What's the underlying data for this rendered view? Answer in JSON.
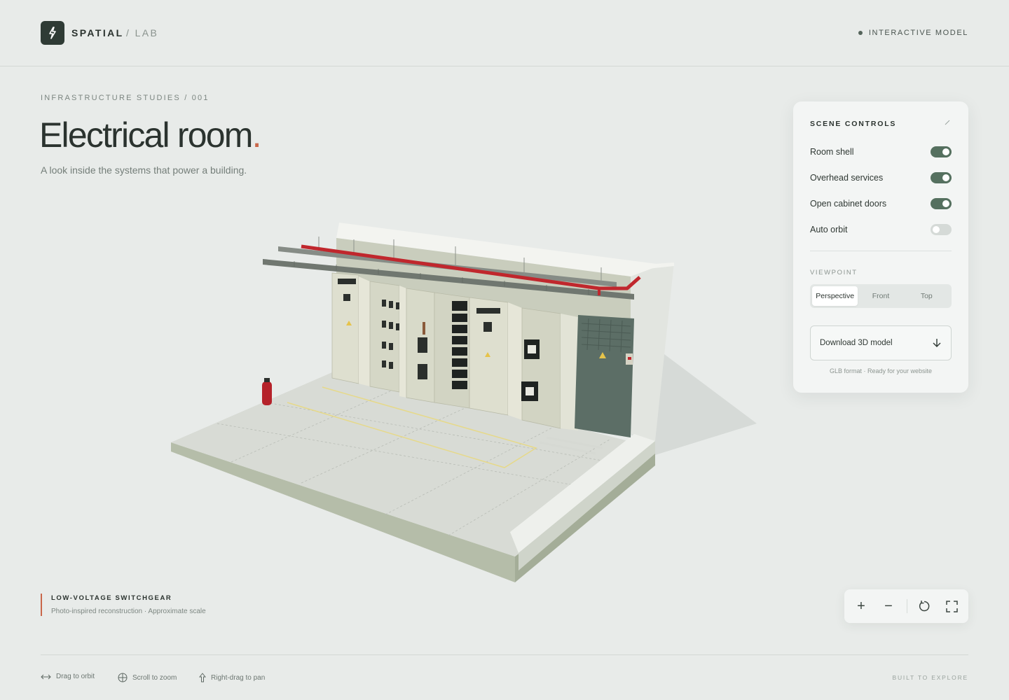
{
  "header": {
    "brand": "SPATIAL",
    "brand_sub": "/ LAB",
    "status": "INTERACTIVE MODEL",
    "logo_icon": "lightning-icon"
  },
  "hero": {
    "eyebrow": "INFRASTRUCTURE STUDIES / 001",
    "title": "Electrical room",
    "title_dot": ".",
    "subtitle": "A look inside the systems that power a building."
  },
  "panel": {
    "title": "SCENE CONTROLS",
    "toggles": [
      {
        "label": "Room shell",
        "on": true
      },
      {
        "label": "Overhead services",
        "on": true
      },
      {
        "label": "Open cabinet doors",
        "on": true
      },
      {
        "label": "Auto orbit",
        "on": false
      }
    ],
    "viewpoint_label": "VIEWPOINT",
    "viewpoints": [
      "Perspective",
      "Front",
      "Top"
    ],
    "active_viewpoint": "Perspective",
    "download_label": "Download 3D model",
    "download_note": "GLB format · Ready for your website"
  },
  "caption": {
    "title": "LOW-VOLTAGE SWITCHGEAR",
    "subtitle": "Photo-inspired reconstruction · Approximate scale"
  },
  "zoom": {
    "zoom_in": "+",
    "zoom_out": "−"
  },
  "footer": {
    "hints": [
      {
        "icon": "arrows-horizontal-icon",
        "label": "Drag to orbit"
      },
      {
        "icon": "crosshair-circle-icon",
        "label": "Scroll to zoom"
      },
      {
        "icon": "arrow-up-icon",
        "label": "Right-drag to pan"
      }
    ],
    "right": "BUILT TO EXPLORE"
  },
  "colors": {
    "background": "#e8ebe9",
    "accent": "#c9674a",
    "toggle_on": "#55705f",
    "pipe_red": "#c0272d"
  }
}
